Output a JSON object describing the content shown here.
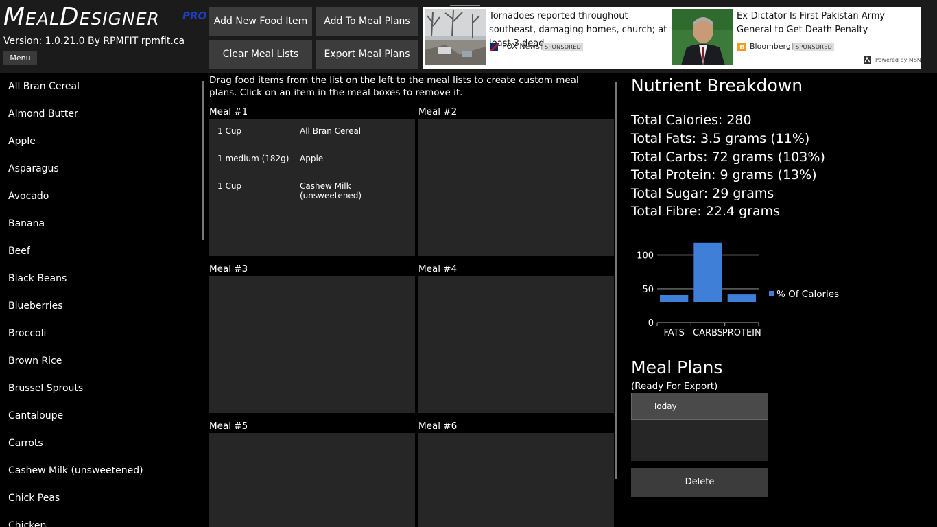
{
  "app": {
    "logo": "MealDesigner",
    "logo_suffix": "PRO",
    "version": "Version: 1.0.21.0 By RPMFIT rpmfit.ca",
    "menu_label": "Menu"
  },
  "toolbar": {
    "add_food": "Add New Food Item",
    "add_to_plans": "Add To Meal Plans",
    "clear_lists": "Clear Meal Lists",
    "export_plans": "Export Meal Plans"
  },
  "ad": {
    "item1": {
      "headline": "Tornadoes reported throughout southeast, damaging homes, church; at least 3 dead",
      "source": "FOX News",
      "tag": "SPONSORED"
    },
    "item2": {
      "headline": "Ex-Dictator Is First Pakistan Army General to Get Death Penalty",
      "source": "Bloomberg",
      "tag": "SPONSORED"
    },
    "powered": "Powered by MSN"
  },
  "food_list": [
    "All Bran Cereal",
    "Almond Butter",
    "Apple",
    "Asparagus",
    "Avocado",
    "Banana",
    "Beef",
    "Black Beans",
    "Blueberries",
    "Broccoli",
    "Brown Rice",
    "Brussel Sprouts",
    "Cantaloupe",
    "Carrots",
    "Cashew Milk (unsweetened)",
    "Chick Peas",
    "Chicken"
  ],
  "instructions": "Drag food items from the list on the left to the meal lists to create custom meal plans.  Click on an item in the meal boxes to remove it.",
  "meals": {
    "m1": {
      "label": "Meal #1",
      "items": [
        {
          "qty": "1 Cup",
          "name": "All Bran Cereal"
        },
        {
          "qty": "1 medium (182g)",
          "name": "Apple"
        },
        {
          "qty": "1 Cup",
          "name": "Cashew Milk (unsweetened)"
        }
      ]
    },
    "m2": {
      "label": "Meal #2"
    },
    "m3": {
      "label": "Meal #3"
    },
    "m4": {
      "label": "Meal #4"
    },
    "m5": {
      "label": "Meal #5"
    },
    "m6": {
      "label": "Meal #6"
    }
  },
  "nutrients": {
    "title": "Nutrient Breakdown",
    "calories": "Total Calories: 280",
    "fats": "Total Fats: 3.5 grams (11%)",
    "carbs": "Total Carbs: 72 grams (103%)",
    "protein": "Total Protein: 9 grams (13%)",
    "sugar": "Total Sugar: 29 grams",
    "fibre": "Total Fibre: 22.4 grams"
  },
  "chart_data": {
    "type": "bar",
    "categories": [
      "FATS",
      "CARBS",
      "PROTEIN"
    ],
    "series": [
      {
        "name": "% Of Calories",
        "values": [
          11,
          103,
          13
        ],
        "color": "#3f7fd8"
      }
    ],
    "ylim": [
      0,
      130
    ],
    "yticks": [
      0,
      50,
      100
    ],
    "grid": true,
    "legend": "right"
  },
  "meal_plans": {
    "title": "Meal Plans",
    "subtitle": "(Ready For Export)",
    "items": [
      "Today"
    ],
    "delete_label": "Delete"
  }
}
